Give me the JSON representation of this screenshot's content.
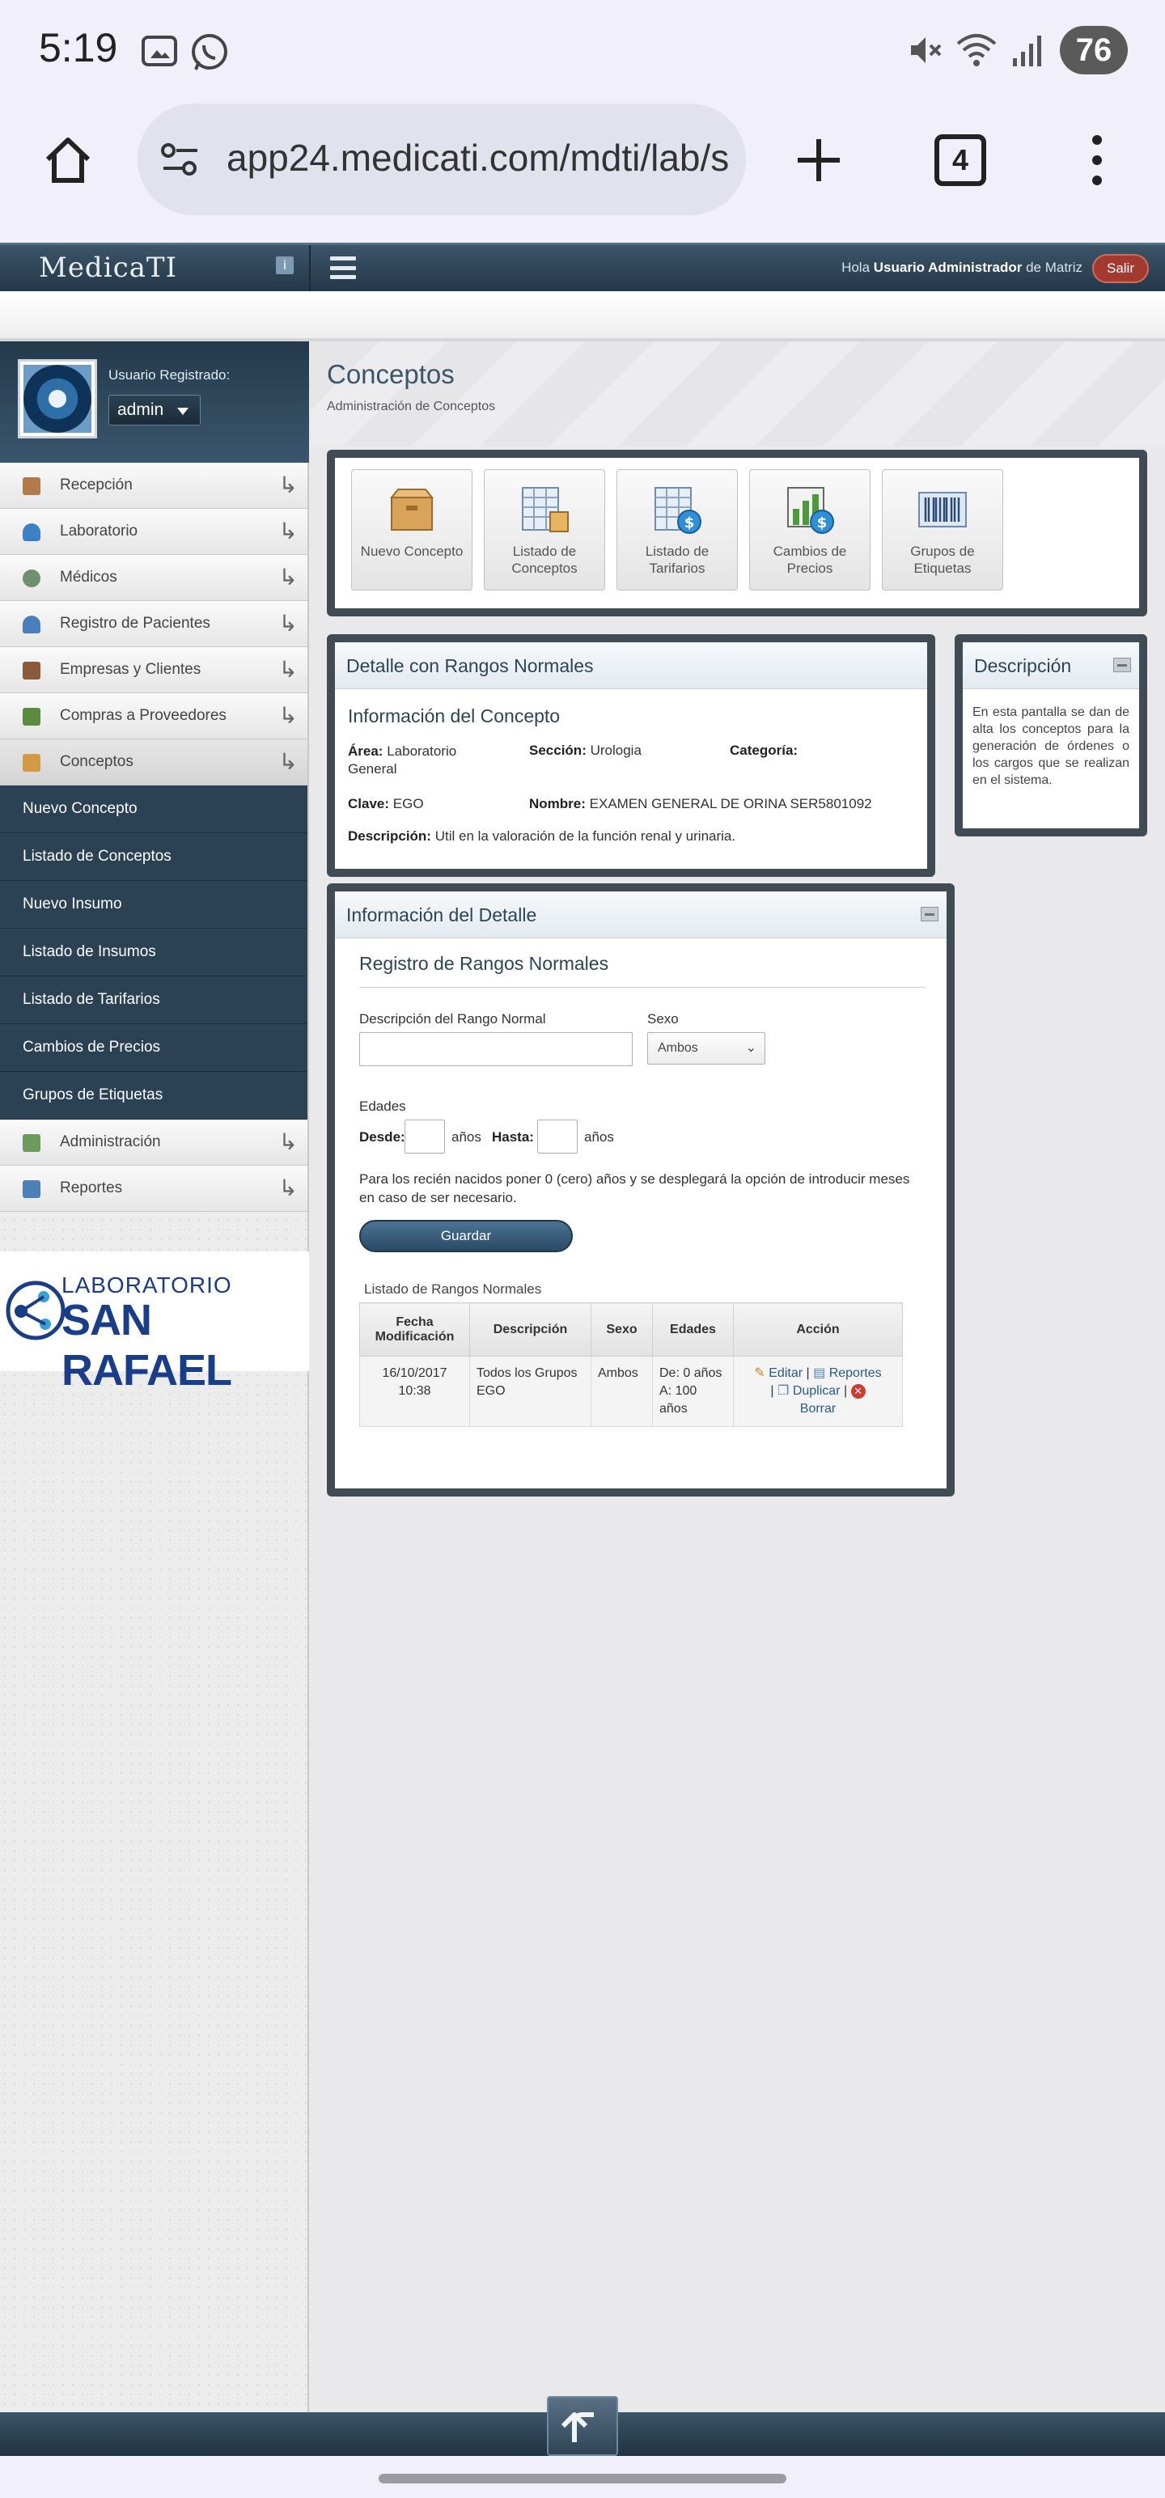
{
  "status": {
    "time": "5:19",
    "battery": "76"
  },
  "browser": {
    "url": "app24.medicati.com/mdti/lab/s",
    "tabs_count": "4"
  },
  "header": {
    "logo": "MedicaTI",
    "greeting_prefix": "Hola",
    "user_name": "Usuario Administrador",
    "greeting_suffix": "de Matriz",
    "logout_label": "Salir"
  },
  "user": {
    "label": "Usuario Registrado:",
    "selected": "admin"
  },
  "menu": {
    "items": [
      {
        "label": "Recepción",
        "icon": "couch-icon",
        "color": "#b07a4a"
      },
      {
        "label": "Laboratorio",
        "icon": "flask-icon",
        "color": "#3b82c4"
      },
      {
        "label": "Médicos",
        "icon": "stethoscope-icon",
        "color": "#6f8f6f"
      },
      {
        "label": "Registro de Pacientes",
        "icon": "patient-icon",
        "color": "#4a7fbf"
      },
      {
        "label": "Empresas y Clientes",
        "icon": "building-icon",
        "color": "#8a5a3a"
      },
      {
        "label": "Compras a Proveedores",
        "icon": "cart-icon",
        "color": "#5d8a3e"
      },
      {
        "label": "Conceptos",
        "icon": "box-icon",
        "color": "#d39a45"
      }
    ],
    "submenu": [
      "Nuevo Concepto",
      "Listado de Conceptos",
      "Nuevo Insumo",
      "Listado de Insumos",
      "Listado de Tarifarios",
      "Cambios de Precios",
      "Grupos de Etiquetas"
    ],
    "items_after": [
      {
        "label": "Administración",
        "icon": "admin-icon",
        "color": "#6e9a5e"
      },
      {
        "label": "Reportes",
        "icon": "report-icon",
        "color": "#4d7fb8"
      }
    ]
  },
  "lab_logo": {
    "line1": "LABORATORIO",
    "line2": "SAN RAFAEL"
  },
  "page": {
    "title": "Conceptos",
    "subtitle": "Administración de Conceptos"
  },
  "tiles": [
    {
      "label": "Nuevo Concepto",
      "icon": "box-icon"
    },
    {
      "label": "Listado de Conceptos",
      "icon": "list-icon"
    },
    {
      "label": "Listado de Tarifarios",
      "icon": "tariff-icon"
    },
    {
      "label": "Cambios de Precios",
      "icon": "price-change-icon"
    },
    {
      "label": "Grupos de Etiquetas",
      "icon": "barcode-icon"
    }
  ],
  "detail": {
    "header": "Detalle con Rangos Normales",
    "section_title": "Información del Concepto",
    "area_label": "Área:",
    "area_value": "Laboratorio General",
    "seccion_label": "Sección:",
    "seccion_value": "Urologia",
    "categoria_label": "Categoría:",
    "categoria_value": "",
    "clave_label": "Clave:",
    "clave_value": "EGO",
    "nombre_label": "Nombre:",
    "nombre_value": "EXAMEN GENERAL DE ORINA SER5801092",
    "descripcion_label": "Descripción:",
    "descripcion_value": "Util en la valoración de la función renal y urinaria."
  },
  "description_panel": {
    "header": "Descripción",
    "text": "En esta pantalla se dan de alta los conceptos para la generación de órdenes o los cargos que se realizan en el sistema."
  },
  "info_detalle": {
    "header": "Información del Detalle",
    "form_title": "Registro de Rangos Normales",
    "desc_label": "Descripción del Rango Normal",
    "desc_value": "",
    "sexo_label": "Sexo",
    "sexo_value": "Ambos",
    "edades_label": "Edades",
    "desde_label": "Desde:",
    "hasta_label": "Hasta:",
    "anos": "años",
    "note": "Para los recién nacidos poner 0 (cero) años y se desplegará la opción de introducir meses en caso de ser necesario.",
    "save_label": "Guardar",
    "list_title": "Listado de Rangos Normales",
    "columns": [
      "Fecha Modificación",
      "Descripción",
      "Sexo",
      "Edades",
      "Acción"
    ],
    "rows": [
      {
        "fecha": "16/10/2017 10:38",
        "descripcion": "Todos los Grupos EGO",
        "sexo": "Ambos",
        "edades": "De: 0 años A: 100 años"
      }
    ],
    "actions": {
      "edit": "Editar",
      "reports": "Reportes",
      "duplicate": "Duplicar",
      "delete": "Borrar",
      "sep": "|"
    }
  }
}
